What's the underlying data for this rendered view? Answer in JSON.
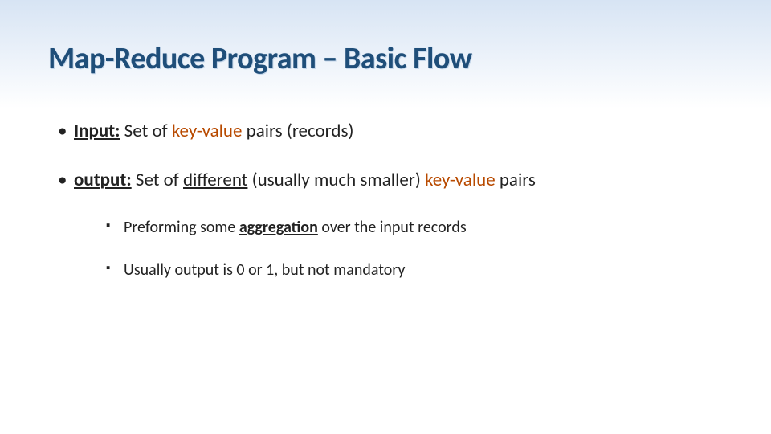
{
  "slide": {
    "title": "Map-Reduce Program – Basic Flow",
    "input_label": "Input:",
    "input_rest_1": " Set of ",
    "input_kv": "key-value",
    "input_rest_2": " pairs (records)",
    "output_label": "output:",
    "output_rest_1": " Set of ",
    "output_diff": "different",
    "output_rest_2": " (usually much smaller) ",
    "output_kv": "key-value",
    "output_rest_3": " pairs",
    "sub1_a": "Preforming some ",
    "sub1_agg": "aggregation",
    "sub1_b": " over the input records",
    "sub2": "Usually output is 0 or 1, but not mandatory"
  }
}
